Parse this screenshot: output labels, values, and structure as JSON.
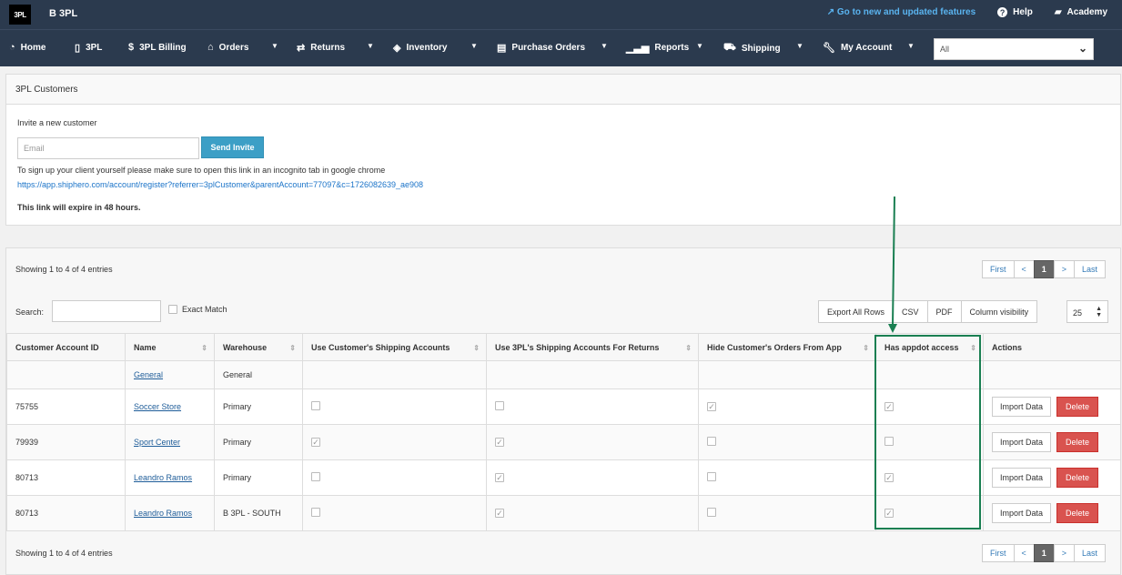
{
  "topbar": {
    "logo": "3PL",
    "brand": "B 3PL",
    "new_features": "Go to new and updated features",
    "help": "Help",
    "academy": "Academy"
  },
  "nav": {
    "items": [
      {
        "label": "Home",
        "icon": "speedometer-icon"
      },
      {
        "label": "3PL",
        "icon": "phone-icon"
      },
      {
        "label": "3PL Billing",
        "icon": "dollar-icon"
      },
      {
        "label": "Orders",
        "icon": "inbox-icon"
      },
      {
        "label": "Returns",
        "icon": "exchange-icon"
      },
      {
        "label": "Inventory",
        "icon": "tag-icon"
      },
      {
        "label": "Purchase Orders",
        "icon": "document-icon"
      },
      {
        "label": "Reports",
        "icon": "signal-icon"
      },
      {
        "label": "Shipping",
        "icon": "truck-icon"
      },
      {
        "label": "My Account",
        "icon": "wrench-icon"
      }
    ],
    "warehouse_select": "All"
  },
  "customers_panel": {
    "title": "3PL Customers",
    "invite_label": "Invite a new customer",
    "email_placeholder": "Email",
    "send_invite": "Send Invite",
    "signup_note": "To sign up your client yourself please make sure to open this link in an incognito tab in google chrome",
    "signup_link": "https://app.shiphero.com/account/register?referrer=3plCustomer&parentAccount=77097&c=1726082639_ae908",
    "expire_note": "This link will expire in 48 hours."
  },
  "table_panel": {
    "showing": "Showing 1 to 4 of 4 entries",
    "pager": {
      "first": "First",
      "prev": "<",
      "page": "1",
      "next": ">",
      "last": "Last"
    },
    "search_label": "Search:",
    "exact_match": "Exact Match",
    "buttons": {
      "export": "Export All Rows",
      "csv": "CSV",
      "pdf": "PDF",
      "colvis": "Column visibility"
    },
    "page_length": "25",
    "columns": [
      "Customer Account ID",
      "Name",
      "Warehouse",
      "Use Customer's Shipping Accounts",
      "Use 3PL's Shipping Accounts For Returns",
      "Hide Customer's Orders From App",
      "Has appdot access",
      "Actions"
    ],
    "rows": [
      {
        "id": "",
        "name": "General",
        "warehouse": "General",
        "use_customer": null,
        "use_3pl_returns": null,
        "hide_orders": null,
        "appdot": null,
        "actions": false
      },
      {
        "id": "75755",
        "name": "Soccer Store",
        "warehouse": "Primary",
        "use_customer": false,
        "use_3pl_returns": false,
        "hide_orders": true,
        "appdot": true,
        "actions": true
      },
      {
        "id": "79939",
        "name": "Sport Center",
        "warehouse": "Primary",
        "use_customer": true,
        "use_3pl_returns": true,
        "hide_orders": false,
        "appdot": false,
        "actions": true
      },
      {
        "id": "80713",
        "name": "Leandro Ramos",
        "warehouse": "Primary",
        "use_customer": false,
        "use_3pl_returns": true,
        "hide_orders": false,
        "appdot": true,
        "actions": true
      },
      {
        "id": "80713",
        "name": "Leandro Ramos",
        "warehouse": "B 3PL - SOUTH",
        "use_customer": false,
        "use_3pl_returns": true,
        "hide_orders": false,
        "appdot": true,
        "actions": true
      }
    ],
    "action_labels": {
      "import": "Import Data",
      "delete": "Delete"
    }
  },
  "colors": {
    "nav_bg": "#2b3a4e",
    "send_btn": "#3c9fc6",
    "delete_btn": "#d9534f",
    "highlight": "#1a7f52",
    "link": "#1a73c8"
  }
}
